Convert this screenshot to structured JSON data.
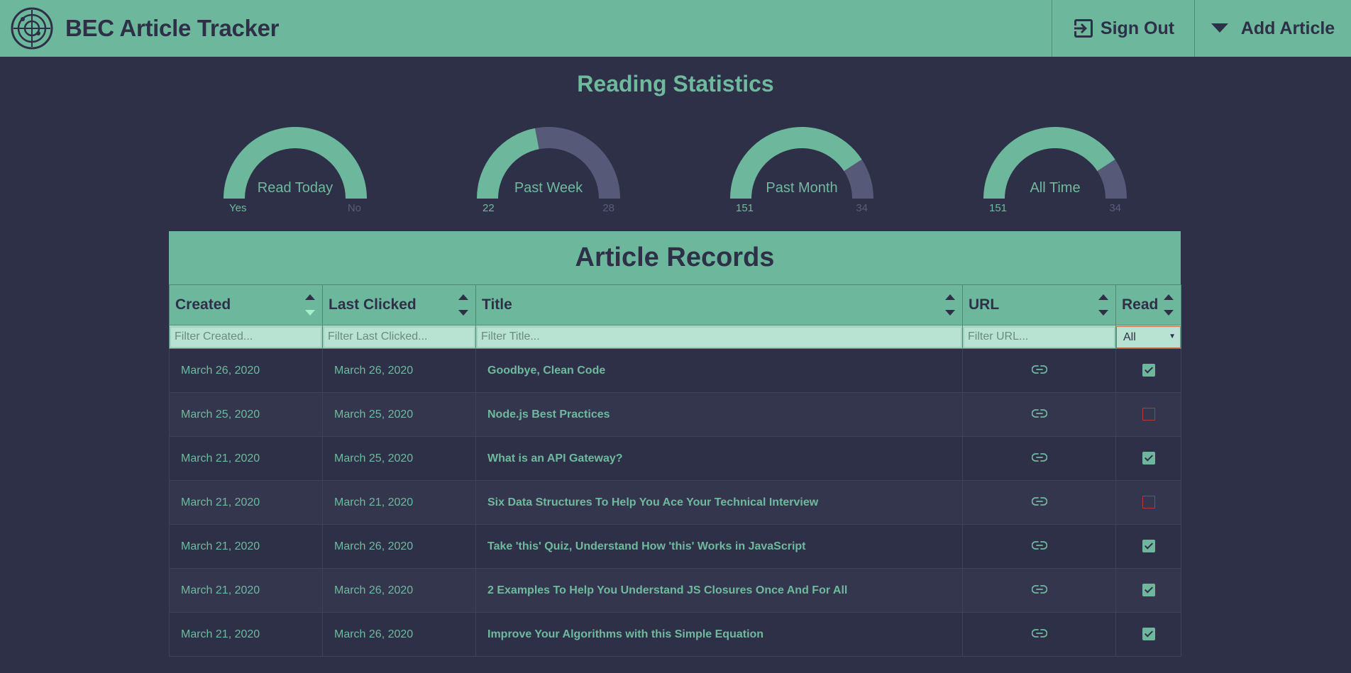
{
  "app": {
    "title": "BEC Article Tracker",
    "sign_out_label": "Sign Out",
    "add_article_label": "Add Article"
  },
  "stats": {
    "title": "Reading Statistics",
    "gauges": [
      {
        "label": "Read Today",
        "min_label": "Yes",
        "max_label": "No",
        "fraction": 1.0
      },
      {
        "label": "Past Week",
        "min_label": "22",
        "max_label": "28",
        "fraction": 0.44
      },
      {
        "label": "Past Month",
        "min_label": "151",
        "max_label": "34",
        "fraction": 0.816
      },
      {
        "label": "All Time",
        "min_label": "151",
        "max_label": "34",
        "fraction": 0.816
      }
    ]
  },
  "records": {
    "title": "Article Records",
    "columns": [
      "Created",
      "Last Clicked",
      "Title",
      "URL",
      "Read"
    ],
    "filters": {
      "created_placeholder": "Filter Created...",
      "last_clicked_placeholder": "Filter Last Clicked...",
      "title_placeholder": "Filter Title...",
      "url_placeholder": "Filter URL...",
      "read_selected": "All"
    },
    "rows": [
      {
        "created": "March 26, 2020",
        "last_clicked": "March 26, 2020",
        "title": "Goodbye, Clean Code",
        "read": true
      },
      {
        "created": "March 25, 2020",
        "last_clicked": "March 25, 2020",
        "title": "Node.js Best Practices",
        "read": false
      },
      {
        "created": "March 21, 2020",
        "last_clicked": "March 25, 2020",
        "title": "What is an API Gateway?",
        "read": true
      },
      {
        "created": "March 21, 2020",
        "last_clicked": "March 21, 2020",
        "title": "Six Data Structures To Help You Ace Your Technical Interview",
        "read": false
      },
      {
        "created": "March 21, 2020",
        "last_clicked": "March 26, 2020",
        "title": "Take 'this' Quiz, Understand How 'this' Works in JavaScript",
        "read": true
      },
      {
        "created": "March 21, 2020",
        "last_clicked": "March 26, 2020",
        "title": "2 Examples To Help You Understand JS Closures Once And For All",
        "read": true
      },
      {
        "created": "March 21, 2020",
        "last_clicked": "March 26, 2020",
        "title": "Improve Your Algorithms with this Simple Equation",
        "read": true
      }
    ]
  },
  "icons": {
    "logo": "radar-icon",
    "sign_out": "sign-out-icon",
    "add_article": "caret-down-icon",
    "url": "link-icon"
  },
  "colors": {
    "accent": "#6db89c",
    "background": "#2e3047",
    "gauge_remainder": "#575979",
    "unread": "#b13a3a"
  }
}
